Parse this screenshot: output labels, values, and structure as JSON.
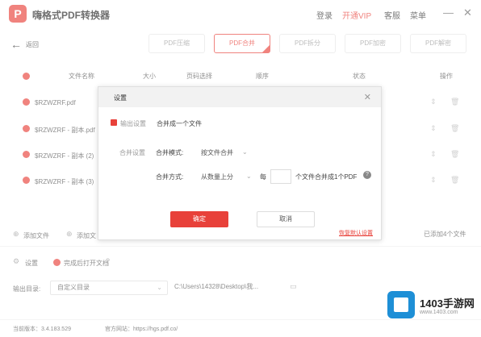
{
  "app": {
    "logo_char": "P",
    "title": "嗨格式PDF转换器"
  },
  "topbar": {
    "login": "登录",
    "vip": "开通VIP",
    "service": "客服",
    "menu": "菜单",
    "minimize": "—",
    "close": "✕"
  },
  "nav": {
    "back_label": "返回",
    "back_icon": "←"
  },
  "tabs": [
    {
      "label": "PDF压缩"
    },
    {
      "label": "PDF合并"
    },
    {
      "label": "PDF拆分"
    },
    {
      "label": "PDF加密"
    },
    {
      "label": "PDF解密"
    }
  ],
  "table": {
    "headers": {
      "name": "文件名称",
      "size": "大小",
      "pages": "页码选择",
      "order": "顺序",
      "status": "状态",
      "action": "操作"
    },
    "rows": [
      {
        "name": "$RZWZRF.pdf"
      },
      {
        "name": "$RZWZRF - 副本.pdf"
      },
      {
        "name": "$RZWZRF - 副本 (2)"
      },
      {
        "name": "$RZWZRF - 副本 (3)"
      }
    ]
  },
  "bottom": {
    "add_file": "添加文件",
    "add_folder": "添加文",
    "file_count": "已添加4个文件",
    "settings": "设置",
    "open_after": "完成后打开文档",
    "output_label": "输出目录:",
    "output_select": "自定义目录",
    "output_path": "C:\\Users\\14328\\Desktop\\我...",
    "version": "当前版本：3.4.183.529",
    "website": "官方网站：https://hgs.pdf.co/"
  },
  "dialog": {
    "title": "设置",
    "close": "✕",
    "output_label": "输出设置",
    "merge_one": "合并成一个文件",
    "merge_setting_label": "合并设置",
    "merge_mode_label": "合并模式:",
    "merge_mode_value": "按文件合并",
    "merge_method_label": "合并方式:",
    "merge_method_value": "从数量上分",
    "per_label": "每",
    "per_suffix": "个文件合并成1个PDF",
    "confirm": "确定",
    "cancel": "取消",
    "link": "恢复默认设置"
  },
  "watermark": {
    "title": "1403手游网",
    "sub": "www.1403.com"
  },
  "colors": {
    "accent": "#e8413a",
    "watermark_blue": "#1e8fd6"
  }
}
